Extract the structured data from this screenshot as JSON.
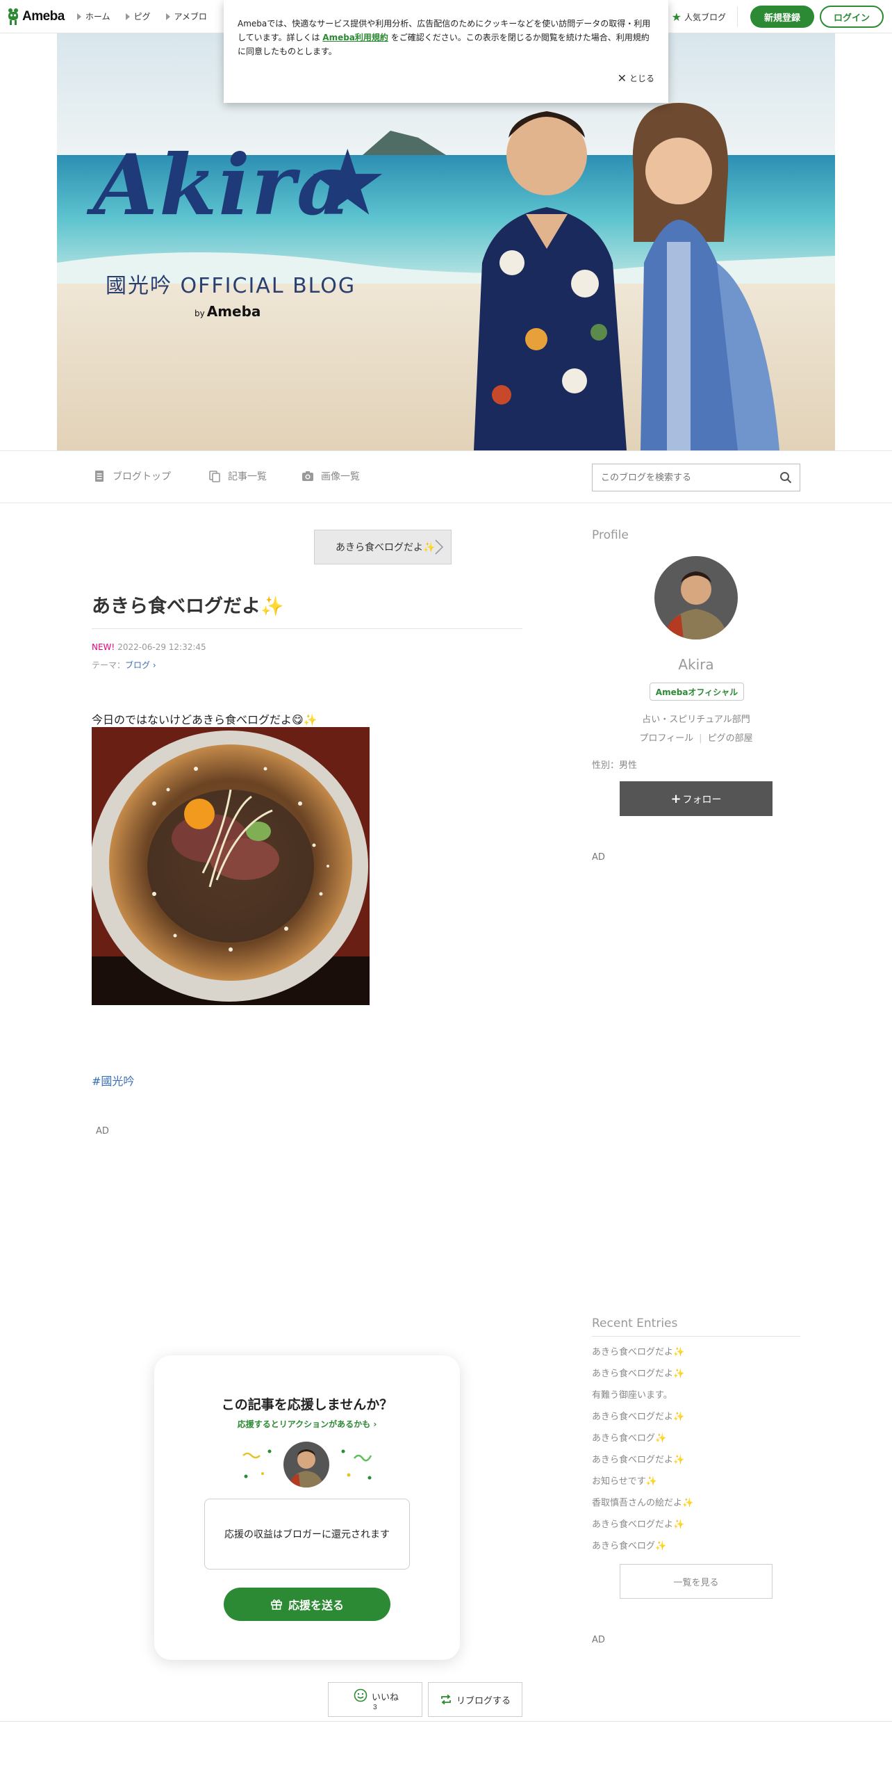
{
  "header": {
    "logo_text": "Ameba",
    "nav": [
      "ホーム",
      "ピグ",
      "アメブロ"
    ],
    "popular_label": "人気ブログ",
    "signup_label": "新規登録",
    "login_label": "ログイン",
    "accent_color": "#2d8a34"
  },
  "cookie_banner": {
    "text_before_link": "Amebaでは、快適なサービス提供や利用分析、広告配信のためにクッキーなどを使い訪問データの取得・利用しています。詳しくは",
    "link_text": "Ameba利用規約",
    "text_after_link": "をご確認ください。この表示を閉じるか閲覧を続けた場合、利用規約に同意したものとします。",
    "close_label": "とじる"
  },
  "hero": {
    "title": "Akira",
    "star": "★",
    "subtitle": "國光吟 OFFICIAL BLOG",
    "by_prefix": "by",
    "by_brand": "Ameba"
  },
  "blog_nav": {
    "items": [
      "ブログトップ",
      "記事一覧",
      "画像一覧"
    ],
    "search_placeholder": "このブログを検索する"
  },
  "article": {
    "prev_label": "あきら食べログだよ✨",
    "title": "あきら食べログだよ✨",
    "new_badge": "NEW!",
    "datetime": "2022-06-29 12:32:45",
    "theme_prefix": "テーマ：",
    "theme": "ブログ",
    "body_text": "今日のではないけどあきら食べログだよ😋✨",
    "hashtag": "#國光吟",
    "ad_label": "AD"
  },
  "support": {
    "title": "この記事を応援しませんか？",
    "subtitle": "応援するとリアクションがあるかも",
    "box_text": "応援の収益はブロガーに還元されます",
    "button_label": "応援を送る"
  },
  "reactions": {
    "like_label": "いいね",
    "like_count": "3",
    "reblog_label": "リブログする"
  },
  "sidebar": {
    "profile_heading": "Profile",
    "name": "Akira",
    "badge": "Amebaオフィシャル",
    "category": "占い・スピリチュアル部門",
    "link_profile": "プロフィール",
    "link_room": "ピグの部屋",
    "sex": "性別：男性",
    "follow_label": "フォロー",
    "ad_label": "AD",
    "recent_heading": "Recent Entries",
    "recent_entries": [
      "あきら食べログだよ✨",
      "あきら食べログだよ✨",
      "有難う御座います。",
      "あきら食べログだよ✨",
      "あきら食べログ✨",
      "あきら食べログだよ✨",
      "お知らせです✨",
      "香取慎吾さんの絵だよ✨",
      "あきら食べログだよ✨",
      "あきら食べログ✨"
    ],
    "more_label": "一覧を見る"
  }
}
